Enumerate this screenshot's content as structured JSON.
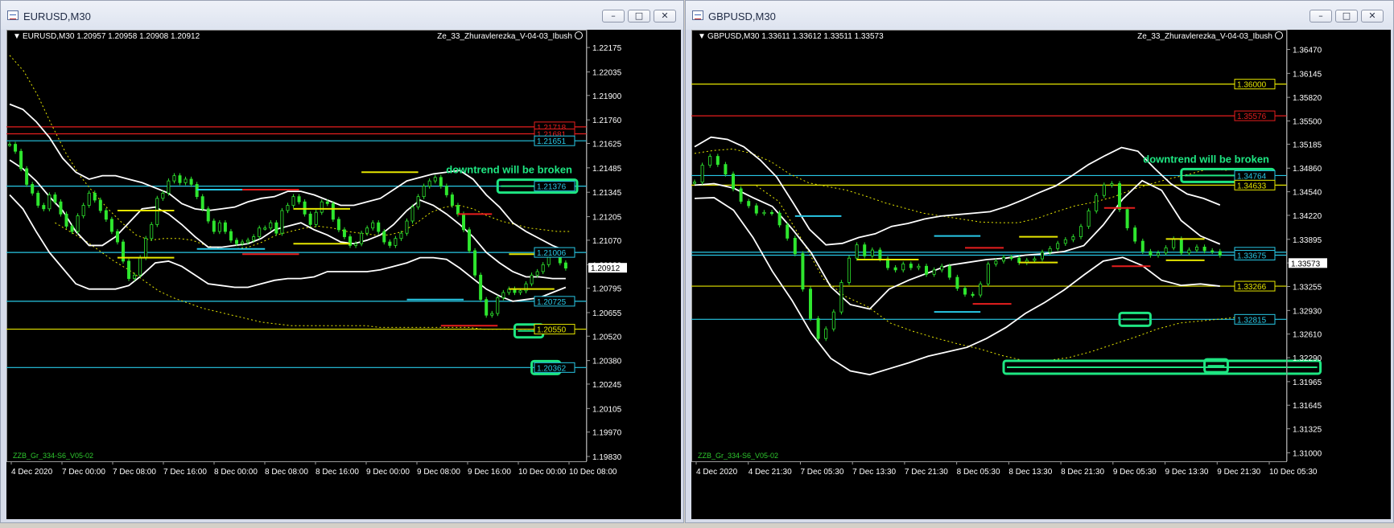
{
  "colors": {
    "background": "#000000",
    "candle": "#2ee62e",
    "band": "#ffffff",
    "yellow": "#e6e600",
    "red": "#e61e1e",
    "cyan": "#28c8e6",
    "callout": "#1ee682",
    "axis_text": "#ffffff"
  },
  "icons": {
    "title": "chart-window-icon",
    "minimize": "minimize-icon",
    "maximize": "maximize-icon",
    "close": "close-icon",
    "smiley": "smiley-icon"
  },
  "windows": [
    {
      "id": "eurusd",
      "title": "EURUSD,M30",
      "buttons": {
        "minimize": "–",
        "maximize": "□",
        "close": "✕"
      },
      "chart": {
        "info": "EURUSD,M30  1.20957 1.20958 1.20908 1.20912",
        "indicator": "Ze_33_Zhuravlerezka_V-04-03_Ibush",
        "footer_label": "ZZB_Gr_334-S6_V05-02",
        "callout_text": "downtrend will be broken",
        "current_price": "1.20912",
        "y_min": 1.1983,
        "y_max": 1.2224,
        "y_ticks": [
          "1.22175",
          "1.22035",
          "1.21900",
          "1.21760",
          "1.21625",
          "1.21485",
          "1.21345",
          "1.21205",
          "1.21070",
          "1.20930",
          "1.20795",
          "1.20655",
          "1.20520",
          "1.20380",
          "1.20245",
          "1.20105",
          "1.19970",
          "1.19830"
        ],
        "x_ticks": [
          "4 Dec 2020",
          "7 Dec 00:00",
          "7 Dec 08:00",
          "7 Dec 16:00",
          "8 Dec 00:00",
          "8 Dec 08:00",
          "8 Dec 16:00",
          "9 Dec 00:00",
          "9 Dec 08:00",
          "9 Dec 16:00",
          "10 Dec 00:00",
          "10 Dec 08:00"
        ],
        "levels": [
          {
            "label": "1.21718",
            "price": 1.2172,
            "color": "red"
          },
          {
            "label": "1.21681",
            "price": 1.2168,
            "color": "red"
          },
          {
            "label": "1.21651",
            "price": 1.2164,
            "color": "cyan"
          },
          {
            "label": "1.21376",
            "price": 1.2138,
            "color": "cyan"
          },
          {
            "label": "1.21006",
            "price": 1.21,
            "color": "cyan"
          },
          {
            "label": "1.20725",
            "price": 1.2072,
            "color": "cyan"
          },
          {
            "label": "1.20550",
            "price": 1.2056,
            "color": "yellow"
          },
          {
            "label": "1.20362",
            "price": 1.2034,
            "color": "cyan"
          }
        ],
        "candles": [
          1.2162,
          1.2158,
          1.2148,
          1.2139,
          1.2134,
          1.2127,
          1.2125,
          1.2133,
          1.2129,
          1.2122,
          1.2115,
          1.2112,
          1.2121,
          1.2127,
          1.2134,
          1.213,
          1.2124,
          1.2119,
          1.2112,
          1.2106,
          1.2095,
          1.2085,
          1.2087,
          1.2097,
          1.2108,
          1.2116,
          1.2131,
          1.2134,
          1.2141,
          1.2144,
          1.214,
          1.2142,
          1.2139,
          1.2132,
          1.2125,
          1.2118,
          1.2112,
          1.2117,
          1.2112,
          1.2107,
          1.2105,
          1.2106,
          1.2107,
          1.2109,
          1.2114,
          1.2114,
          1.2117,
          1.2111,
          1.2124,
          1.2127,
          1.2132,
          1.2129,
          1.2122,
          1.2116,
          1.2123,
          1.2129,
          1.2128,
          1.2119,
          1.2113,
          1.2109,
          1.2104,
          1.2105,
          1.2111,
          1.2114,
          1.2117,
          1.2112,
          1.2106,
          1.2104,
          1.2108,
          1.2111,
          1.2118,
          1.2126,
          1.2132,
          1.2138,
          1.2141,
          1.2143,
          1.2138,
          1.2133,
          1.2127,
          1.2122,
          1.2113,
          1.2101,
          1.2087,
          1.2073,
          1.2064,
          1.2065,
          1.2074,
          1.2077,
          1.2079,
          1.2077,
          1.2078,
          1.2082,
          1.2087,
          1.2089,
          1.2093,
          1.2099,
          1.2101,
          1.2094,
          1.2091
        ],
        "upper_band": [
          1.2185,
          1.2182,
          1.2175,
          1.2166,
          1.2154,
          1.2146,
          1.2142,
          1.2144,
          1.2144,
          1.2142,
          1.214,
          1.2137,
          1.2134,
          1.2128,
          1.2125,
          1.2124,
          1.2125,
          1.2126,
          1.2129,
          1.2131,
          1.2132,
          1.2135,
          1.2135,
          1.2133,
          1.213,
          1.2127,
          1.2127,
          1.2129,
          1.2131,
          1.2136,
          1.2141,
          1.2143,
          1.2145,
          1.2146,
          1.2147,
          1.2142,
          1.2133,
          1.2126,
          1.2117,
          1.2112,
          1.2108,
          1.2104,
          1.2101
        ],
        "middle_band": [
          1.2153,
          1.2148,
          1.2141,
          1.2132,
          1.2124,
          1.2112,
          1.2104,
          1.2104,
          1.2109,
          1.2117,
          1.2125,
          1.2126,
          1.2122,
          1.2116,
          1.2109,
          1.2103,
          1.2103,
          1.2104,
          1.2105,
          1.2108,
          1.2113,
          1.2115,
          1.2117,
          1.2113,
          1.211,
          1.2106,
          1.2105,
          1.2107,
          1.211,
          1.2116,
          1.2124,
          1.213,
          1.2127,
          1.2122,
          1.2116,
          1.2109,
          1.21,
          1.2094,
          1.2089,
          1.2086,
          1.2086,
          1.2085,
          1.2085
        ],
        "lower_band": [
          1.2133,
          1.2125,
          1.2112,
          1.21,
          1.2091,
          1.2082,
          1.2079,
          1.2079,
          1.2079,
          1.2081,
          1.2087,
          1.2094,
          1.2095,
          1.2092,
          1.2087,
          1.2082,
          1.2081,
          1.208,
          1.208,
          1.2082,
          1.2084,
          1.2085,
          1.2085,
          1.2086,
          1.2089,
          1.2089,
          1.2089,
          1.2089,
          1.209,
          1.2092,
          1.2094,
          1.2097,
          1.2097,
          1.2096,
          1.2091,
          1.2085,
          1.2079,
          1.2075,
          1.2072,
          1.2073,
          1.2074,
          1.2077,
          1.208
        ],
        "dotted_upper": [
          1.2213,
          1.2204,
          1.219,
          1.2173,
          1.2157,
          1.2144,
          1.2134,
          1.2125,
          1.2117,
          1.211,
          1.2107,
          1.2108,
          1.2108,
          1.2107,
          1.2104,
          1.2102,
          1.2102,
          1.2103,
          1.2106,
          1.211,
          1.2112,
          1.2114,
          1.2115,
          1.2114,
          1.2112,
          1.2111,
          1.211,
          1.211,
          1.2112,
          1.2117,
          1.2123,
          1.2126,
          1.2127,
          1.2125,
          1.2121,
          1.2118,
          1.2116,
          1.2114,
          1.2113,
          1.2112,
          1.2112
        ],
        "dotted_lower": [
          1.2117,
          1.2112,
          1.2107,
          1.2101,
          1.2095,
          1.209,
          1.2084,
          1.2078,
          1.2074,
          1.2071,
          1.2068,
          1.2066,
          1.2064,
          1.2062,
          1.206,
          1.2059,
          1.2058,
          1.2058,
          1.2058,
          1.2058,
          1.2058,
          1.2058,
          1.2057,
          1.2057,
          1.2057,
          1.2057,
          1.2057,
          1.2057,
          1.2057,
          1.2056,
          1.2056,
          1.2056,
          1.2056,
          1.2056,
          1.2055,
          1.2055
        ],
        "signal_marks": [
          {
            "bar": 19,
            "price": 1.2124,
            "color": "yellow",
            "bars": 10
          },
          {
            "bar": 19,
            "price": 1.2097,
            "color": "yellow",
            "bars": 10
          },
          {
            "bar": 33,
            "price": 1.2136,
            "color": "cyan",
            "bars": 12
          },
          {
            "bar": 41,
            "price": 1.2136,
            "color": "red",
            "bars": 10
          },
          {
            "bar": 33,
            "price": 1.2102,
            "color": "cyan",
            "bars": 12
          },
          {
            "bar": 41,
            "price": 1.2099,
            "color": "red",
            "bars": 10
          },
          {
            "bar": 50,
            "price": 1.2125,
            "color": "yellow",
            "bars": 10
          },
          {
            "bar": 50,
            "price": 1.2105,
            "color": "yellow",
            "bars": 10
          },
          {
            "bar": 62,
            "price": 1.2146,
            "color": "yellow",
            "bars": 10
          },
          {
            "bar": 79,
            "price": 1.2122,
            "color": "red",
            "bars": 6
          },
          {
            "bar": 70,
            "price": 1.2073,
            "color": "cyan",
            "bars": 10
          },
          {
            "bar": 76,
            "price": 1.2058,
            "color": "red",
            "bars": 10
          },
          {
            "bar": 88,
            "price": 1.2079,
            "color": "yellow",
            "bars": 8
          },
          {
            "bar": 88,
            "price": 1.2099,
            "color": "yellow",
            "bars": 8
          }
        ],
        "callouts": [
          {
            "bar_from": 86,
            "bar_to": 100,
            "price": 1.2138
          },
          {
            "bar_from": 89,
            "bar_to": 94,
            "price": 1.2055
          },
          {
            "bar_from": 92,
            "bar_to": 97,
            "price": 1.2034
          }
        ]
      }
    },
    {
      "id": "gbpusd",
      "title": "GBPUSD,M30",
      "buttons": {
        "minimize": "–",
        "maximize": "□",
        "close": "✕"
      },
      "chart": {
        "info": "GBPUSD,M30  1.33611 1.33612 1.33511 1.33573",
        "indicator": "Ze_33_Zhuravlerezka_V-04-03_Ibush",
        "footer_label": "ZZB_Gr_334-S6_V05-02",
        "callout_text": "downtrend will be broken",
        "current_price": "1.33573",
        "y_min": 1.3095,
        "y_max": 1.3665,
        "y_ticks": [
          "1.36470",
          "1.36145",
          "1.35820",
          "1.35500",
          "1.35185",
          "1.34860",
          "1.34540",
          "1.34220",
          "1.33895",
          "1.33575",
          "1.33255",
          "1.32930",
          "1.32610",
          "1.32290",
          "1.31965",
          "1.31645",
          "1.31325",
          "1.31000"
        ],
        "x_ticks": [
          "4 Dec 2020",
          "4 Dec 21:30",
          "7 Dec 05:30",
          "7 Dec 13:30",
          "7 Dec 21:30",
          "8 Dec 05:30",
          "8 Dec 13:30",
          "8 Dec 21:30",
          "9 Dec 05:30",
          "9 Dec 13:30",
          "9 Dec 21:30",
          "10 Dec 05:30"
        ],
        "levels": [
          {
            "label": "1.36000",
            "price": 1.36,
            "color": "yellow"
          },
          {
            "label": "1.35576",
            "price": 1.3557,
            "color": "red"
          },
          {
            "label": "1.34764",
            "price": 1.3476,
            "color": "cyan"
          },
          {
            "label": "1.34633",
            "price": 1.3463,
            "color": "yellow"
          },
          {
            "label": "1.33727",
            "price": 1.3372,
            "color": "cyan"
          },
          {
            "label": "1.33675",
            "price": 1.3368,
            "color": "cyan"
          },
          {
            "label": "1.33266",
            "price": 1.3326,
            "color": "yellow"
          },
          {
            "label": "1.32815",
            "price": 1.3281,
            "color": "cyan"
          }
        ],
        "candles": [
          1.3467,
          1.349,
          1.3502,
          1.3491,
          1.3478,
          1.3458,
          1.3441,
          1.3435,
          1.3425,
          1.3426,
          1.3425,
          1.3409,
          1.3391,
          1.337,
          1.3322,
          1.3282,
          1.3255,
          1.3268,
          1.3291,
          1.3331,
          1.3364,
          1.3382,
          1.3367,
          1.3375,
          1.3363,
          1.3351,
          1.3348,
          1.3356,
          1.3351,
          1.3353,
          1.3342,
          1.3348,
          1.3353,
          1.3338,
          1.3323,
          1.3315,
          1.3314,
          1.3329,
          1.3356,
          1.336,
          1.3365,
          1.3364,
          1.3358,
          1.3361,
          1.3363,
          1.3372,
          1.3377,
          1.3384,
          1.3389,
          1.3393,
          1.3407,
          1.3428,
          1.3449,
          1.3463,
          1.3465,
          1.343,
          1.3405,
          1.3387,
          1.3373,
          1.3368,
          1.3371,
          1.3378,
          1.339,
          1.3371,
          1.3375,
          1.3379,
          1.3374,
          1.3373,
          1.3368
        ],
        "upper_band": [
          1.3515,
          1.3528,
          1.3525,
          1.3515,
          1.3497,
          1.3474,
          1.3439,
          1.3403,
          1.3382,
          1.3384,
          1.3392,
          1.3397,
          1.3407,
          1.3411,
          1.3417,
          1.3421,
          1.3423,
          1.3425,
          1.3427,
          1.3434,
          1.3443,
          1.3453,
          1.3462,
          1.3476,
          1.3491,
          1.3503,
          1.3514,
          1.3509,
          1.3486,
          1.3465,
          1.3451,
          1.3445,
          1.3436
        ],
        "middle_band": [
          1.3463,
          1.3465,
          1.3459,
          1.3446,
          1.3434,
          1.3404,
          1.3371,
          1.3325,
          1.3301,
          1.3295,
          1.3322,
          1.3334,
          1.3344,
          1.3354,
          1.3358,
          1.3362,
          1.3364,
          1.3368,
          1.337,
          1.3373,
          1.3381,
          1.3409,
          1.3444,
          1.3469,
          1.3456,
          1.3415,
          1.3394,
          1.3383
        ],
        "lower_band": [
          1.3445,
          1.3446,
          1.3429,
          1.3392,
          1.3346,
          1.3307,
          1.3262,
          1.3228,
          1.3211,
          1.3206,
          1.3214,
          1.3222,
          1.3231,
          1.3237,
          1.3243,
          1.3255,
          1.327,
          1.3289,
          1.3304,
          1.3321,
          1.3341,
          1.336,
          1.3365,
          1.3354,
          1.3334,
          1.3327,
          1.3329,
          1.3326
        ],
        "dotted_upper": [
          1.3506,
          1.351,
          1.3512,
          1.3506,
          1.3495,
          1.3478,
          1.3466,
          1.3461,
          1.3456,
          1.3448,
          1.3439,
          1.3432,
          1.3425,
          1.3421,
          1.3417,
          1.3413,
          1.3412,
          1.3412,
          1.3418,
          1.3427,
          1.3435,
          1.344,
          1.3447,
          1.3457,
          1.3465,
          1.3472,
          1.3478,
          1.3485,
          1.3483
        ],
        "dotted_lower": [
          1.3462,
          1.3441,
          1.3391,
          1.3336,
          1.3312,
          1.3298,
          1.3276,
          1.3265,
          1.3256,
          1.3248,
          1.3241,
          1.3232,
          1.3225,
          1.3225,
          1.3229,
          1.3237,
          1.3247,
          1.3257,
          1.3268,
          1.3276,
          1.3279,
          1.3282,
          1.3285
        ],
        "signal_marks": [
          {
            "bar": 13,
            "price": 1.3421,
            "color": "cyan",
            "bars": 6
          },
          {
            "bar": 21,
            "price": 1.3362,
            "color": "yellow",
            "bars": 8
          },
          {
            "bar": 31,
            "price": 1.3394,
            "color": "cyan",
            "bars": 6
          },
          {
            "bar": 35,
            "price": 1.3378,
            "color": "red",
            "bars": 5
          },
          {
            "bar": 31,
            "price": 1.3291,
            "color": "cyan",
            "bars": 6
          },
          {
            "bar": 36,
            "price": 1.3302,
            "color": "red",
            "bars": 5
          },
          {
            "bar": 42,
            "price": 1.3393,
            "color": "yellow",
            "bars": 5
          },
          {
            "bar": 42,
            "price": 1.3358,
            "color": "yellow",
            "bars": 5
          },
          {
            "bar": 53,
            "price": 1.3432,
            "color": "red",
            "bars": 4
          },
          {
            "bar": 54,
            "price": 1.3353,
            "color": "red",
            "bars": 5
          },
          {
            "bar": 61,
            "price": 1.339,
            "color": "yellow",
            "bars": 5
          },
          {
            "bar": 61,
            "price": 1.3361,
            "color": "yellow",
            "bars": 5
          }
        ],
        "callouts": [
          {
            "bar_from": 63,
            "bar_to": 75,
            "price": 1.3476
          },
          {
            "bar_from": 55,
            "bar_to": 59,
            "price": 1.3281
          },
          {
            "bar_from": 40,
            "bar_to": 81,
            "price": 1.3216
          },
          {
            "bar_from": 66,
            "bar_to": 69,
            "price": 1.3218
          }
        ]
      }
    }
  ]
}
